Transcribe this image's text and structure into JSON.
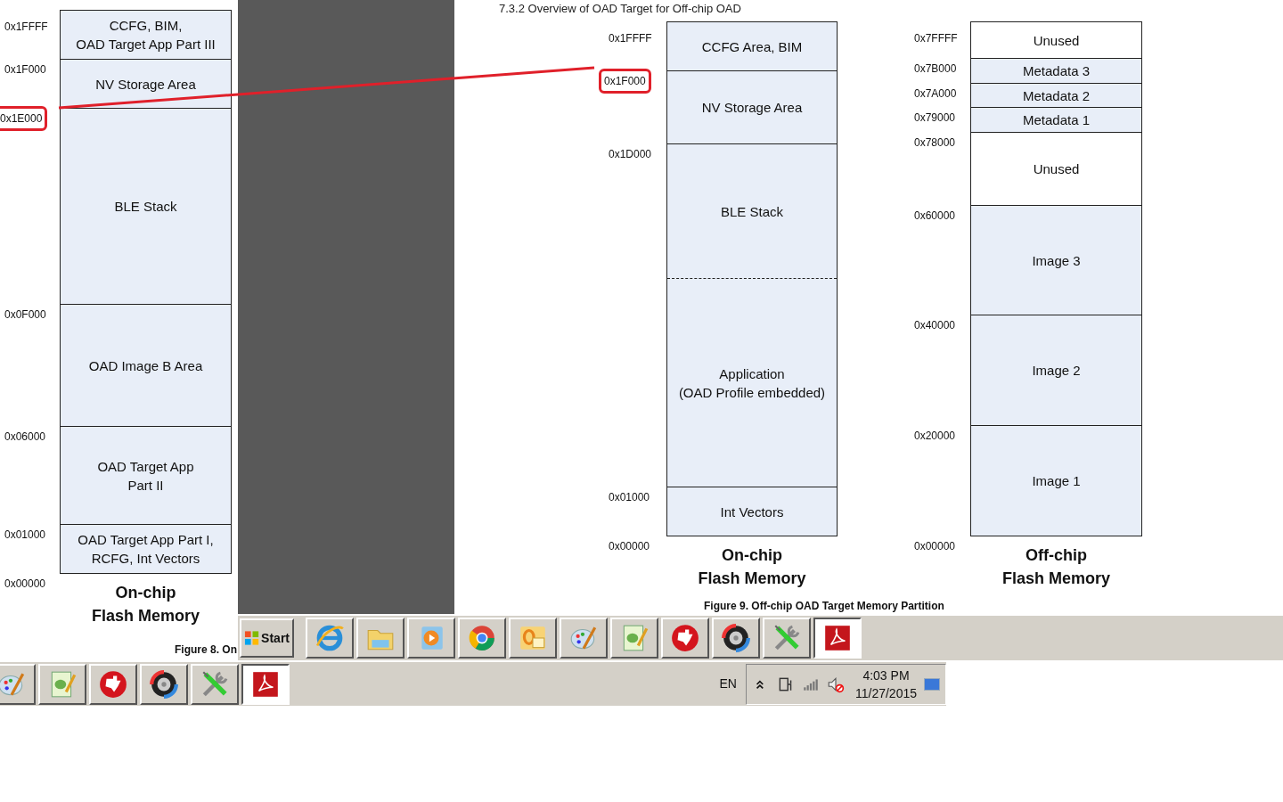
{
  "section_heading": "7.3.2 Overview of OAD Target for Off-chip OAD",
  "diagrams": [
    {
      "blocks": [
        {
          "lines": [
            "CCFG, BIM,",
            "OAD Target App Part III"
          ],
          "shaded": true,
          "dashed_divider": false
        },
        {
          "lines": [
            "NV Storage Area"
          ],
          "shaded": true,
          "dashed_divider": false
        },
        {
          "lines": [
            "BLE Stack"
          ],
          "shaded": true,
          "dashed_divider": false
        },
        {
          "lines": [
            "OAD Image B Area"
          ],
          "shaded": true,
          "dashed_divider": false
        },
        {
          "lines": [
            "OAD Target App",
            "Part II"
          ],
          "shaded": true,
          "dashed_divider": false
        },
        {
          "lines": [
            "OAD Target App Part I,",
            "RCFG, Int Vectors"
          ],
          "shaded": true,
          "dashed_divider": false
        }
      ],
      "addresses": [
        {
          "text": "0x1FFFF",
          "highlighted": false
        },
        {
          "text": "0x1F000",
          "highlighted": false
        },
        {
          "text": "0x1E000",
          "highlighted": true
        },
        {
          "text": "0x0F000",
          "highlighted": false
        },
        {
          "text": "0x06000",
          "highlighted": false
        },
        {
          "text": "0x01000",
          "highlighted": false
        },
        {
          "text": "0x00000",
          "highlighted": false
        }
      ],
      "caption": [
        "On-chip",
        "Flash Memory"
      ],
      "figure_caption": "Figure 8. On"
    },
    {
      "blocks": [
        {
          "lines": [
            "CCFG Area, BIM"
          ],
          "shaded": true,
          "dashed_divider": false
        },
        {
          "lines": [
            "NV Storage Area"
          ],
          "shaded": true,
          "dashed_divider": false
        },
        {
          "lines": [
            "BLE Stack"
          ],
          "shaded": true,
          "dashed_divider": true
        },
        {
          "lines": [
            "Application",
            "(OAD Profile embedded)"
          ],
          "shaded": true,
          "dashed_divider": false
        },
        {
          "lines": [
            "Int Vectors"
          ],
          "shaded": true,
          "dashed_divider": false
        }
      ],
      "addresses": [
        {
          "text": "0x1FFFF",
          "highlighted": false
        },
        {
          "text": "0x1F000",
          "highlighted": true
        },
        {
          "text": "0x1D000",
          "highlighted": false
        },
        {
          "text": "0x01000",
          "highlighted": false
        },
        {
          "text": "0x00000",
          "highlighted": false
        }
      ],
      "caption": [
        "On-chip",
        "Flash Memory"
      ],
      "figure_caption": "Figure 9. Off-chip OAD Target Memory Partition"
    },
    {
      "blocks": [
        {
          "lines": [
            "Unused"
          ],
          "shaded": false,
          "dashed_divider": false
        },
        {
          "lines": [
            "Metadata 3"
          ],
          "shaded": true,
          "dashed_divider": false
        },
        {
          "lines": [
            "Metadata 2"
          ],
          "shaded": true,
          "dashed_divider": false
        },
        {
          "lines": [
            "Metadata 1"
          ],
          "shaded": true,
          "dashed_divider": false
        },
        {
          "lines": [
            "Unused"
          ],
          "shaded": false,
          "dashed_divider": false
        },
        {
          "lines": [
            "Image 3"
          ],
          "shaded": true,
          "dashed_divider": false
        },
        {
          "lines": [
            "Image 2"
          ],
          "shaded": true,
          "dashed_divider": false
        },
        {
          "lines": [
            "Image 1"
          ],
          "shaded": true,
          "dashed_divider": false
        }
      ],
      "addresses": [
        {
          "text": "0x7FFFF",
          "highlighted": false
        },
        {
          "text": "0x7B000",
          "highlighted": false
        },
        {
          "text": "0x7A000",
          "highlighted": false
        },
        {
          "text": "0x79000",
          "highlighted": false
        },
        {
          "text": "0x78000",
          "highlighted": false
        },
        {
          "text": "0x60000",
          "highlighted": false
        },
        {
          "text": "0x40000",
          "highlighted": false
        },
        {
          "text": "0x20000",
          "highlighted": false
        },
        {
          "text": "0x00000",
          "highlighted": false
        }
      ],
      "caption": [
        "Off-chip",
        "Flash Memory"
      ]
    }
  ],
  "taskbar_upper": {
    "start_label": "Start",
    "items": [
      {
        "kind": "browser",
        "selected": false
      },
      {
        "kind": "folder",
        "selected": false
      },
      {
        "kind": "player",
        "selected": false
      },
      {
        "kind": "round",
        "selected": false
      },
      {
        "kind": "mail",
        "selected": false
      },
      {
        "kind": "palette",
        "selected": false
      },
      {
        "kind": "notepad",
        "selected": false
      },
      {
        "kind": "logo",
        "selected": false
      },
      {
        "kind": "disc",
        "selected": false
      },
      {
        "kind": "tools",
        "selected": false
      },
      {
        "kind": "pdf",
        "selected": true
      }
    ]
  },
  "taskbar_lower": {
    "items": [
      {
        "kind": "palette",
        "selected": false
      },
      {
        "kind": "notepad",
        "selected": false
      },
      {
        "kind": "logo",
        "selected": false
      },
      {
        "kind": "disc",
        "selected": false
      },
      {
        "kind": "tools",
        "selected": false
      },
      {
        "kind": "pdf",
        "selected": true
      }
    ],
    "language": "EN",
    "time": "4:03 PM",
    "date": "11/27/2015"
  }
}
